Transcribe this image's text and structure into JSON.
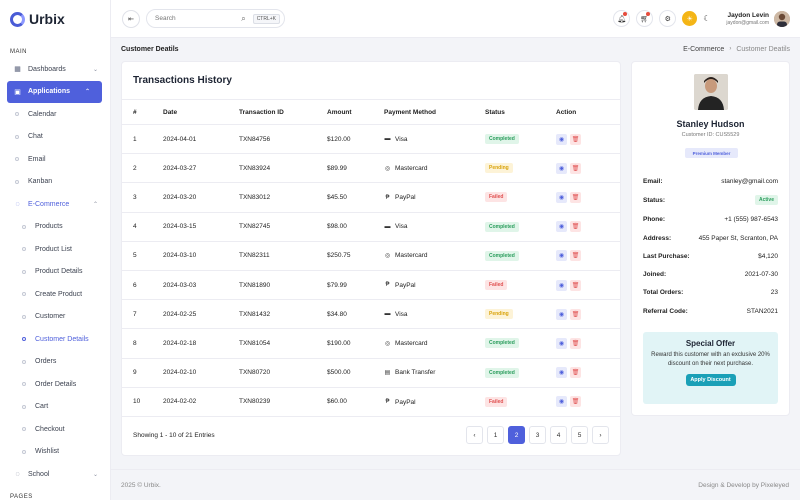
{
  "app": {
    "brand": "Urbix"
  },
  "sidebar": {
    "section_main": "MAIN",
    "section_pages": "PAGES",
    "items": [
      {
        "label": "Dashboards",
        "icon": "dashboard-icon",
        "chev": "⌄"
      },
      {
        "label": "Applications",
        "icon": "apps-icon",
        "chev": "⌃"
      },
      {
        "label": "Calendar"
      },
      {
        "label": "Chat"
      },
      {
        "label": "Email"
      },
      {
        "label": "Kanban"
      },
      {
        "label": "E-Commerce",
        "chev": "⌃"
      },
      {
        "label": "Products"
      },
      {
        "label": "Product List"
      },
      {
        "label": "Product Details"
      },
      {
        "label": "Create Product"
      },
      {
        "label": "Customer"
      },
      {
        "label": "Customer Details"
      },
      {
        "label": "Orders"
      },
      {
        "label": "Order Details"
      },
      {
        "label": "Cart"
      },
      {
        "label": "Checkout"
      },
      {
        "label": "Wishlist"
      },
      {
        "label": "School",
        "chev": "⌄"
      }
    ]
  },
  "topbar": {
    "search_placeholder": "Search",
    "search_shortcut": "CTRL+K",
    "user_name": "Jaydon Levin",
    "user_email": "jaydon@gmail.com"
  },
  "page": {
    "title": "Customer Deatils",
    "breadcrumb": [
      "E-Commerce",
      "Customer Deatils"
    ]
  },
  "transactions": {
    "title": "Transactions History",
    "columns": [
      "#",
      "Date",
      "Transaction ID",
      "Amount",
      "Payment Method",
      "Status",
      "Action"
    ],
    "rows": [
      {
        "n": "1",
        "date": "2024-04-01",
        "id": "TXN84756",
        "amount": "$120.00",
        "method": "Visa",
        "status": "Completed"
      },
      {
        "n": "2",
        "date": "2024-03-27",
        "id": "TXN83924",
        "amount": "$89.99",
        "method": "Mastercard",
        "status": "Pending"
      },
      {
        "n": "3",
        "date": "2024-03-20",
        "id": "TXN83012",
        "amount": "$45.50",
        "method": "PayPal",
        "status": "Failed"
      },
      {
        "n": "4",
        "date": "2024-03-15",
        "id": "TXN82745",
        "amount": "$98.00",
        "method": "Visa",
        "status": "Completed"
      },
      {
        "n": "5",
        "date": "2024-03-10",
        "id": "TXN82311",
        "amount": "$250.75",
        "method": "Mastercard",
        "status": "Completed"
      },
      {
        "n": "6",
        "date": "2024-03-03",
        "id": "TXN81890",
        "amount": "$79.99",
        "method": "PayPal",
        "status": "Failed"
      },
      {
        "n": "7",
        "date": "2024-02-25",
        "id": "TXN81432",
        "amount": "$34.80",
        "method": "Visa",
        "status": "Pending"
      },
      {
        "n": "8",
        "date": "2024-02-18",
        "id": "TXN81054",
        "amount": "$190.00",
        "method": "Mastercard",
        "status": "Completed"
      },
      {
        "n": "9",
        "date": "2024-02-10",
        "id": "TXN80720",
        "amount": "$500.00",
        "method": "Bank Transfer",
        "status": "Completed"
      },
      {
        "n": "10",
        "date": "2024-02-02",
        "id": "TXN80239",
        "amount": "$60.00",
        "method": "PayPal",
        "status": "Failed"
      }
    ],
    "showing": "Showing 1 - 10 of 21 Entries",
    "pages": [
      "‹",
      "1",
      "2",
      "3",
      "4",
      "5",
      "›"
    ],
    "active_page": "2"
  },
  "customer": {
    "name": "Stanley Hudson",
    "id": "Customer ID: CUS5529",
    "tier": "Premium Member",
    "fields": [
      {
        "k": "Email:",
        "v": "stanley@gmail.com"
      },
      {
        "k": "Status:",
        "v": "Active"
      },
      {
        "k": "Phone:",
        "v": "+1 (555) 987-6543"
      },
      {
        "k": "Address:",
        "v": "455 Paper St, Scranton, PA"
      },
      {
        "k": "Last Purchase:",
        "v": "$4,120"
      },
      {
        "k": "Joined:",
        "v": "2021-07-30"
      },
      {
        "k": "Total Orders:",
        "v": "23"
      },
      {
        "k": "Referral Code:",
        "v": "STAN2021"
      }
    ],
    "offer_title": "Special Offer",
    "offer_text": "Reward this customer with an exclusive 20% discount on their next purchase.",
    "offer_button": "Apply Discount"
  },
  "footer": {
    "copyright": "2025 © Urbix.",
    "credit": "Design & Develop by Pixeleyed"
  },
  "colors": {
    "accent": "#4f60dc",
    "completed": "#2a9d5c",
    "pending": "#d9a30b",
    "failed": "#e05050",
    "offer_bg": "#e1f4f6",
    "offer_button": "#1aa0b7"
  }
}
